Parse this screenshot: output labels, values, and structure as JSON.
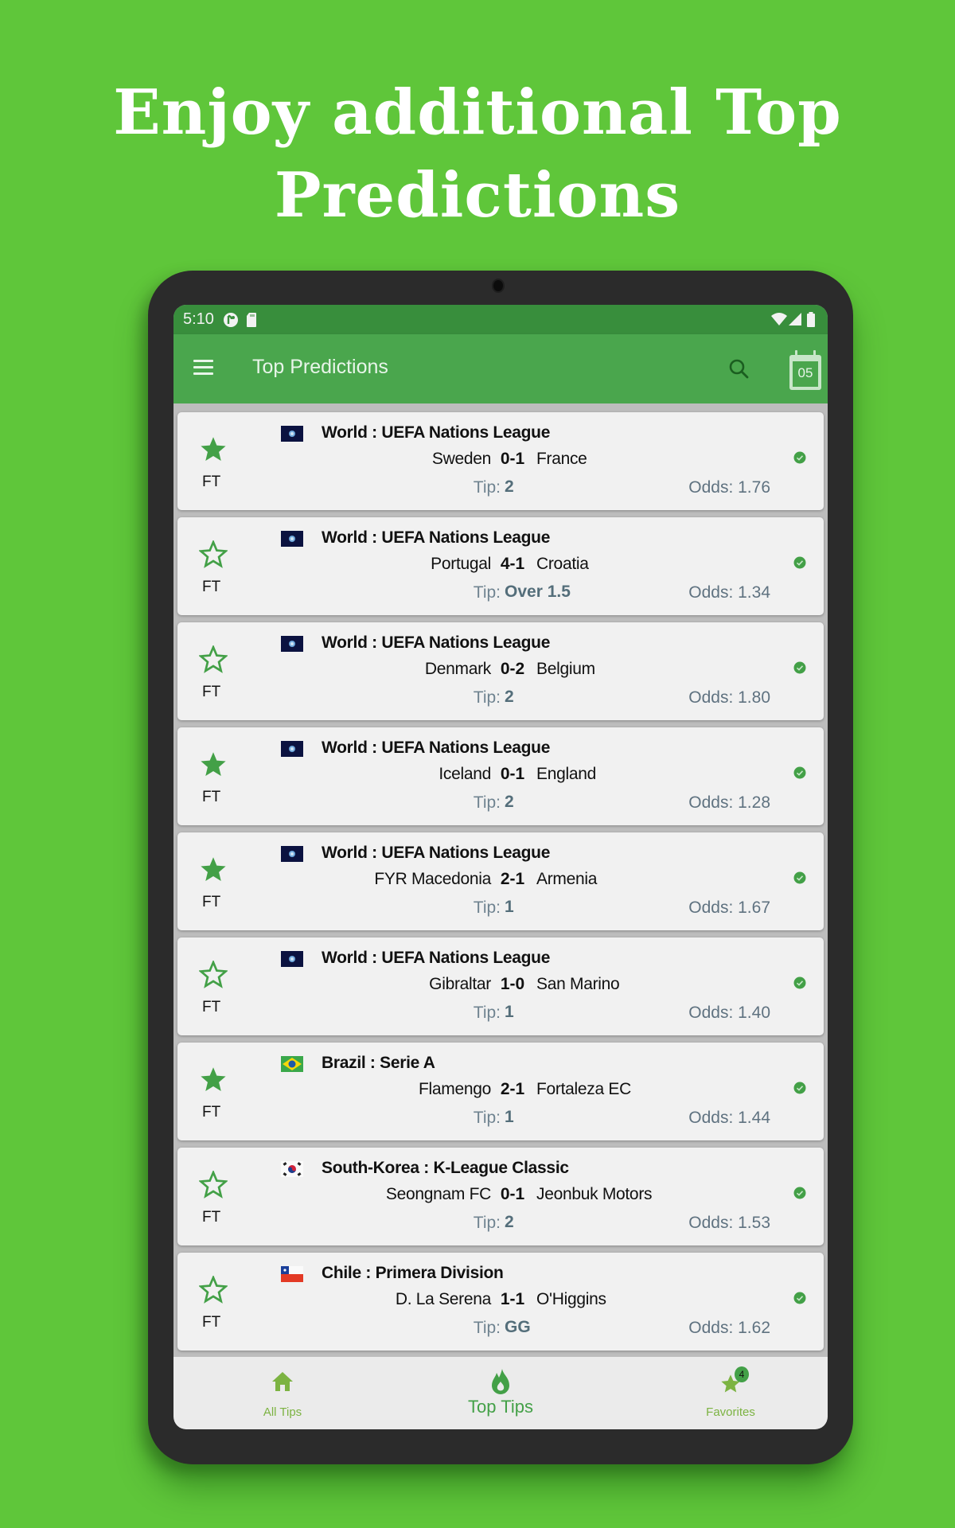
{
  "headline": {
    "line1": "Enjoy additional Top",
    "line2": "Predictions"
  },
  "statusbar": {
    "time": "5:10",
    "icons": [
      "pocket-casts-icon",
      "sd-card-icon",
      "wifi-icon",
      "signal-icon",
      "battery-icon"
    ]
  },
  "appbar": {
    "menu_icon": "hamburger-icon",
    "title": "Top Predictions",
    "search_icon": "search-icon",
    "calendar_day": "05"
  },
  "colors": {
    "background": "#5fc63a",
    "statusbar": "#388e3c",
    "appbar": "#4aa64d",
    "accent": "#43a047",
    "tip_value": "#546e7a"
  },
  "matches": [
    {
      "favorite": true,
      "status": "FT",
      "flag": "world",
      "league": "World : UEFA Nations League",
      "home": "Sweden",
      "score": "0-1",
      "away": "France",
      "tip_label": "Tip:",
      "tip": "2",
      "odds": "Odds: 1.76",
      "won": true
    },
    {
      "favorite": false,
      "status": "FT",
      "flag": "world",
      "league": "World : UEFA Nations League",
      "home": "Portugal",
      "score": "4-1",
      "away": "Croatia",
      "tip_label": "Tip:",
      "tip": "Over 1.5",
      "odds": "Odds: 1.34",
      "won": true
    },
    {
      "favorite": false,
      "status": "FT",
      "flag": "world",
      "league": "World : UEFA Nations League",
      "home": "Denmark",
      "score": "0-2",
      "away": "Belgium",
      "tip_label": "Tip:",
      "tip": "2",
      "odds": "Odds: 1.80",
      "won": true
    },
    {
      "favorite": true,
      "status": "FT",
      "flag": "world",
      "league": "World : UEFA Nations League",
      "home": "Iceland",
      "score": "0-1",
      "away": "England",
      "tip_label": "Tip:",
      "tip": "2",
      "odds": "Odds: 1.28",
      "won": true
    },
    {
      "favorite": true,
      "status": "FT",
      "flag": "world",
      "league": "World : UEFA Nations League",
      "home": "FYR Macedonia",
      "score": "2-1",
      "away": "Armenia",
      "tip_label": "Tip:",
      "tip": "1",
      "odds": "Odds: 1.67",
      "won": true
    },
    {
      "favorite": false,
      "status": "FT",
      "flag": "world",
      "league": "World : UEFA Nations League",
      "home": "Gibraltar",
      "score": "1-0",
      "away": "San Marino",
      "tip_label": "Tip:",
      "tip": "1",
      "odds": "Odds: 1.40",
      "won": true
    },
    {
      "favorite": true,
      "status": "FT",
      "flag": "brazil",
      "league": "Brazil : Serie A",
      "home": "Flamengo",
      "score": "2-1",
      "away": "Fortaleza EC",
      "tip_label": "Tip:",
      "tip": "1",
      "odds": "Odds: 1.44",
      "won": true
    },
    {
      "favorite": false,
      "status": "FT",
      "flag": "south-korea",
      "league": "South-Korea : K-League Classic",
      "home": "Seongnam FC",
      "score": "0-1",
      "away": "Jeonbuk Motors",
      "tip_label": "Tip:",
      "tip": "2",
      "odds": "Odds: 1.53",
      "won": true
    },
    {
      "favorite": false,
      "status": "FT",
      "flag": "chile",
      "league": "Chile : Primera Division",
      "home": "D. La Serena",
      "score": "1-1",
      "away": "O'Higgins",
      "tip_label": "Tip:",
      "tip": "GG",
      "odds": "Odds: 1.62",
      "won": true
    }
  ],
  "bottomnav": {
    "items": [
      {
        "label": "All Tips",
        "icon": "home-icon",
        "active": false
      },
      {
        "label": "Top Tips",
        "icon": "fire-icon",
        "active": true
      },
      {
        "label": "Favorites",
        "icon": "star-icon",
        "active": false,
        "badge": "4"
      }
    ]
  }
}
